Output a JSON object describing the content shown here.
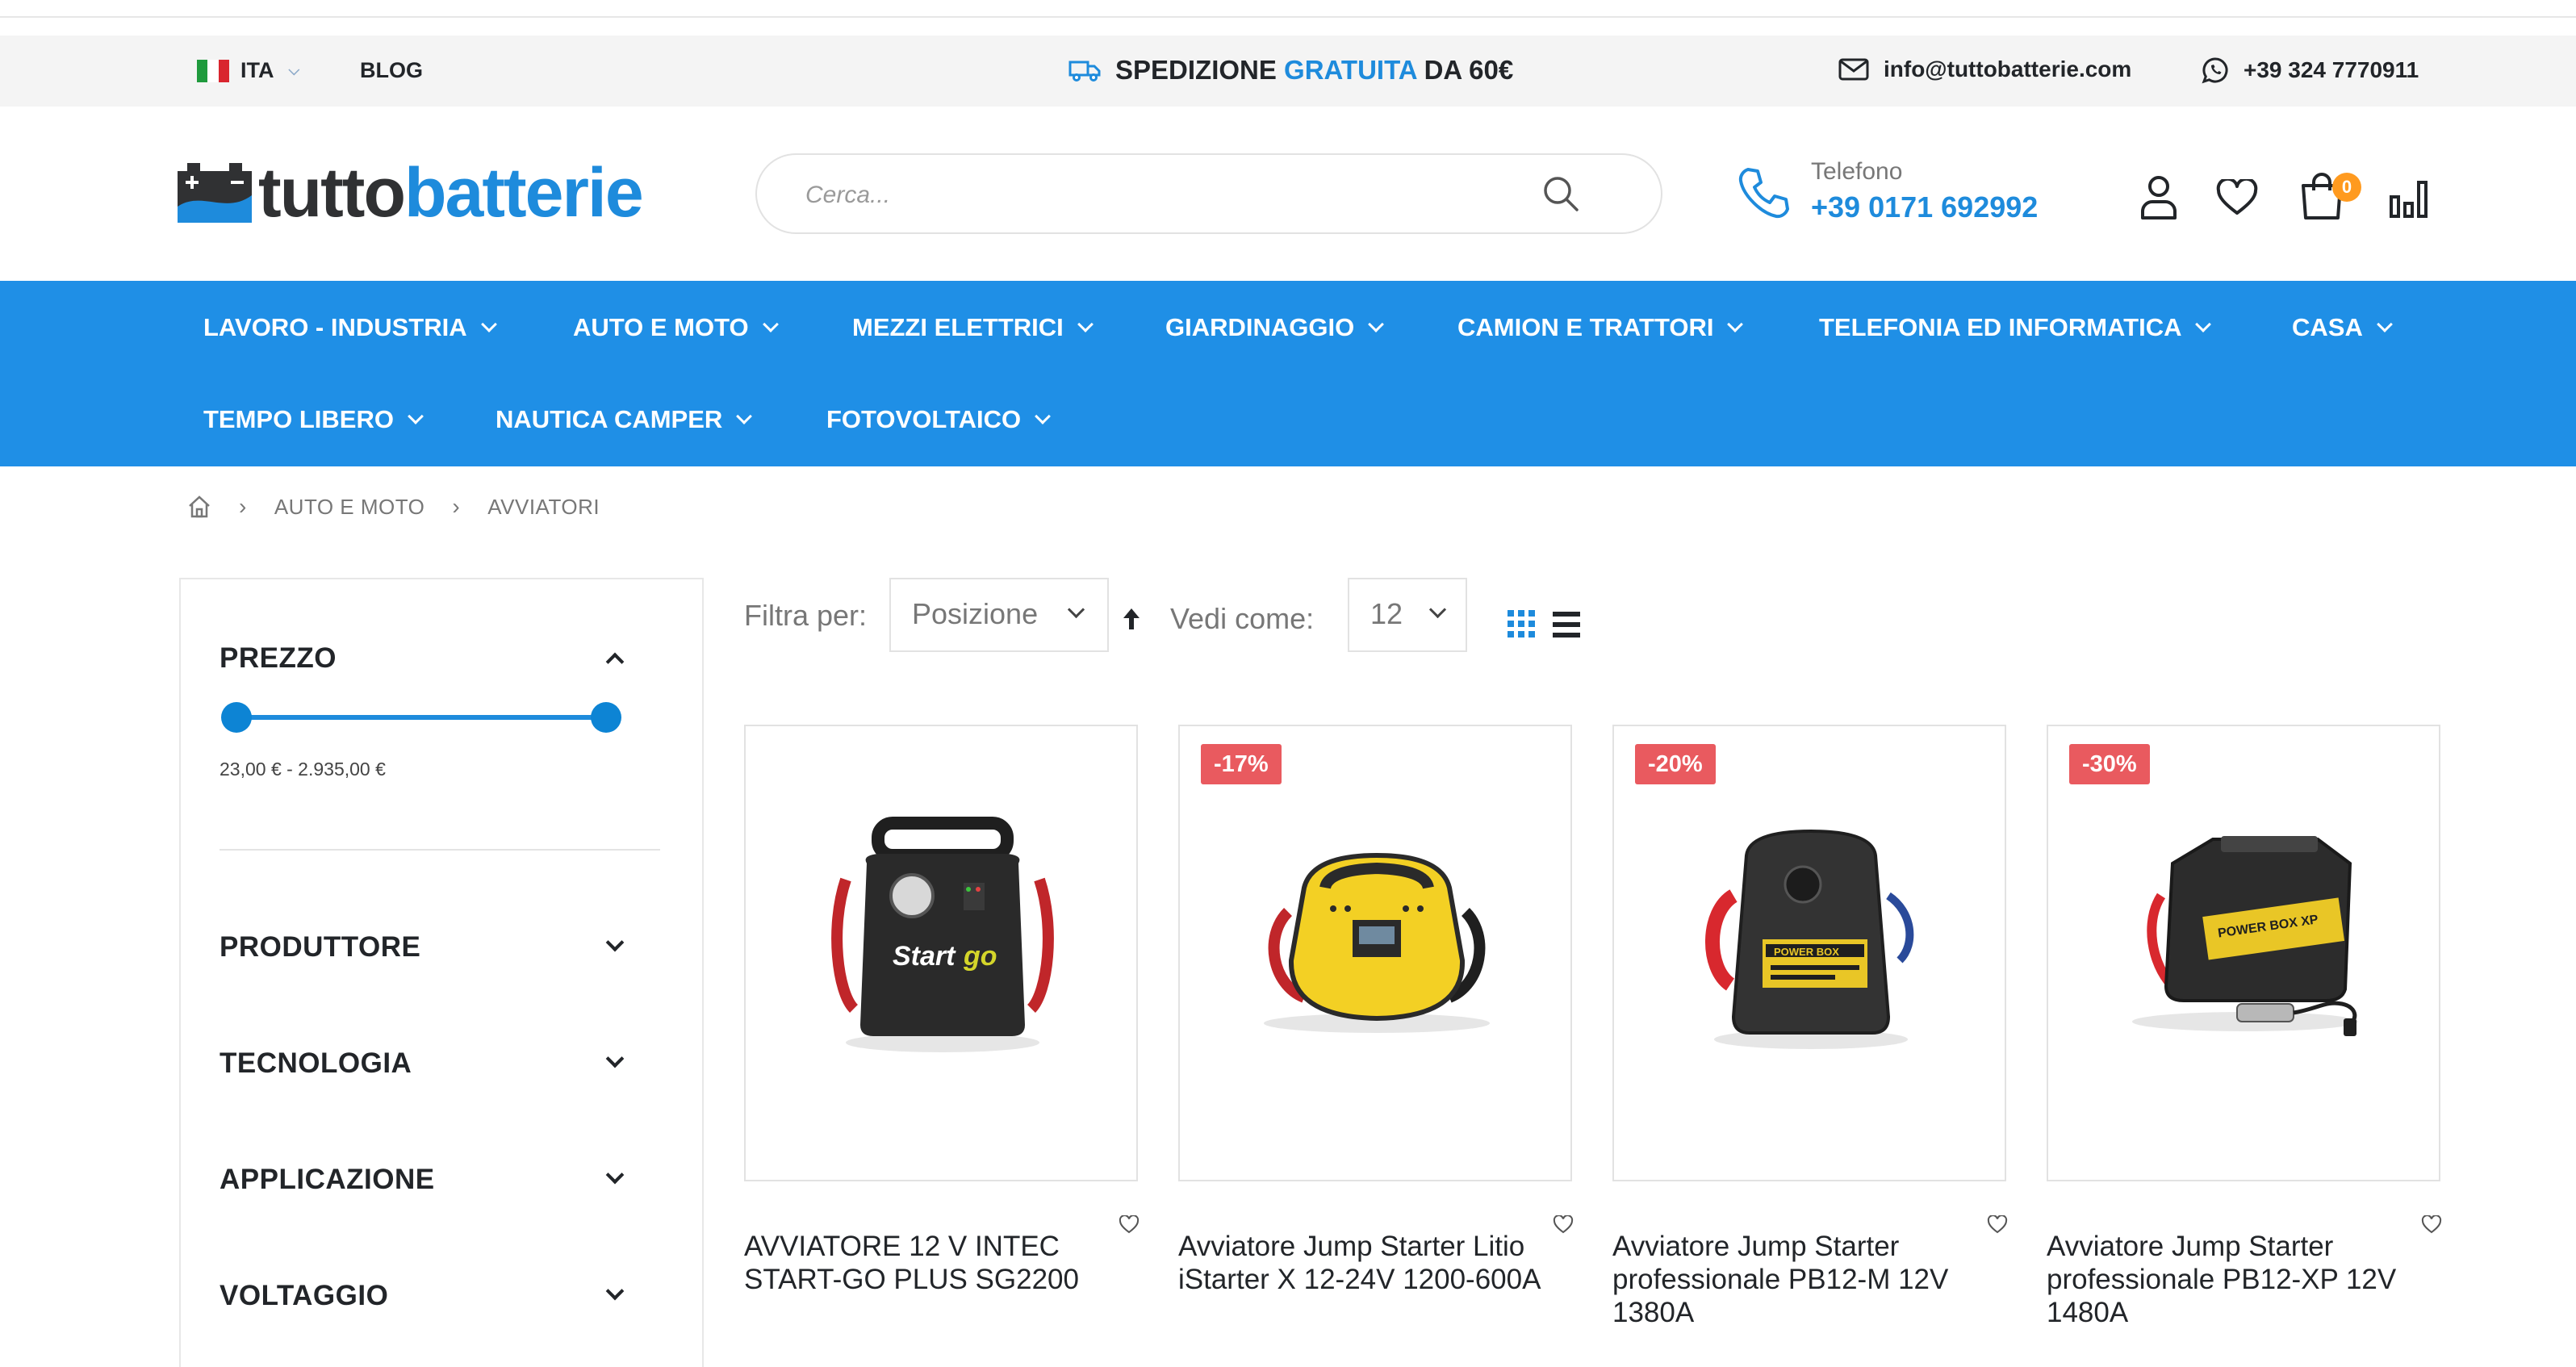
{
  "topbar": {
    "language": "ITA",
    "blog": "BLOG",
    "shipping_prefix": "SPEDIZIONE",
    "shipping_highlight": "GRATUITA",
    "shipping_suffix": "DA 60€",
    "email": "info@tuttobatterie.com",
    "whatsapp": "+39 324 7770911"
  },
  "header": {
    "logo_part1": "tutto",
    "logo_part2": "batterie",
    "search_placeholder": "Cerca...",
    "phone_label": "Telefono",
    "phone_number": "+39 0171 692992",
    "cart_count": "0"
  },
  "nav": {
    "items": [
      "LAVORO - INDUSTRIA",
      "AUTO E MOTO",
      "MEZZI ELETTRICI",
      "GIARDINAGGIO",
      "CAMION E TRATTORI",
      "TELEFONIA ED INFORMATICA",
      "CASA",
      "TEMPO LIBERO",
      "NAUTICA CAMPER",
      "FOTOVOLTAICO"
    ]
  },
  "breadcrumb": [
    "AUTO E MOTO",
    "AVVIATORI"
  ],
  "sidebar": {
    "price_title": "PREZZO",
    "price_range": "23,00 € - 2.935,00 €",
    "filters": [
      "PRODUTTORE",
      "TECNOLOGIA",
      "APPLICAZIONE",
      "VOLTAGGIO"
    ]
  },
  "toolbar": {
    "sort_label": "Filtra per:",
    "sort_value": "Posizione",
    "view_label": "Vedi come:",
    "limit_value": "12"
  },
  "products": [
    {
      "title": "AVVIATORE 12 V INTEC START-GO PLUS SG2200",
      "discount": ""
    },
    {
      "title": "Avviatore Jump Starter Litio iStarter X 12-24V 1200-600A",
      "discount": "-17%"
    },
    {
      "title": "Avviatore Jump Starter professionale PB12-M 12V 1380A",
      "discount": "-20%"
    },
    {
      "title": "Avviatore Jump Starter professionale PB12-XP 12V 1480A",
      "discount": "-30%"
    }
  ],
  "colors": {
    "brand_blue": "#1f8fe6",
    "discount_red": "#e95a5f",
    "cart_badge": "#ff9a1f"
  }
}
